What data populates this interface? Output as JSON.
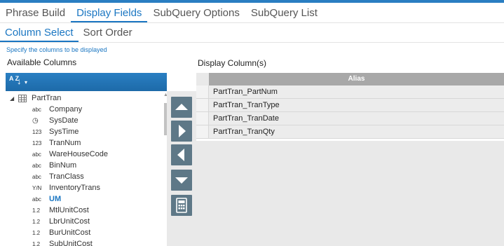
{
  "tabs_primary": [
    {
      "label": "Phrase Build"
    },
    {
      "label": "Display Fields"
    },
    {
      "label": "SubQuery Options"
    },
    {
      "label": "SubQuery List"
    }
  ],
  "tabs_secondary": [
    {
      "label": "Column Select"
    },
    {
      "label": "Sort Order"
    }
  ],
  "hint": "Specify the columns to be displayed",
  "available": {
    "label": "Available Columns",
    "sort_icon_az": "A Z",
    "root": {
      "label": "PartTran",
      "expanded": true
    },
    "fields": [
      {
        "type": "abc",
        "name": "Company"
      },
      {
        "type": "◷",
        "name": "SysDate"
      },
      {
        "type": "123",
        "name": "SysTime"
      },
      {
        "type": "123",
        "name": "TranNum"
      },
      {
        "type": "abc",
        "name": "WareHouseCode"
      },
      {
        "type": "abc",
        "name": "BinNum"
      },
      {
        "type": "abc",
        "name": "TranClass"
      },
      {
        "type": "Y/N",
        "name": "InventoryTrans"
      },
      {
        "type": "abc",
        "name": "UM"
      },
      {
        "type": "1.2",
        "name": "MtlUnitCost"
      },
      {
        "type": "1.2",
        "name": "LbrUnitCost"
      },
      {
        "type": "1.2",
        "name": "BurUnitCost"
      },
      {
        "type": "1.2",
        "name": "SubUnitCost"
      }
    ]
  },
  "display": {
    "label": "Display Column(s)",
    "header": "Alias",
    "rows": [
      "PartTran_PartNum",
      "PartTran_TranType",
      "PartTran_TranDate",
      "PartTran_TranQty"
    ]
  },
  "colors": {
    "accent": "#1a76c2",
    "button": "#5e7887",
    "grid_header": "#a8a8a8"
  }
}
